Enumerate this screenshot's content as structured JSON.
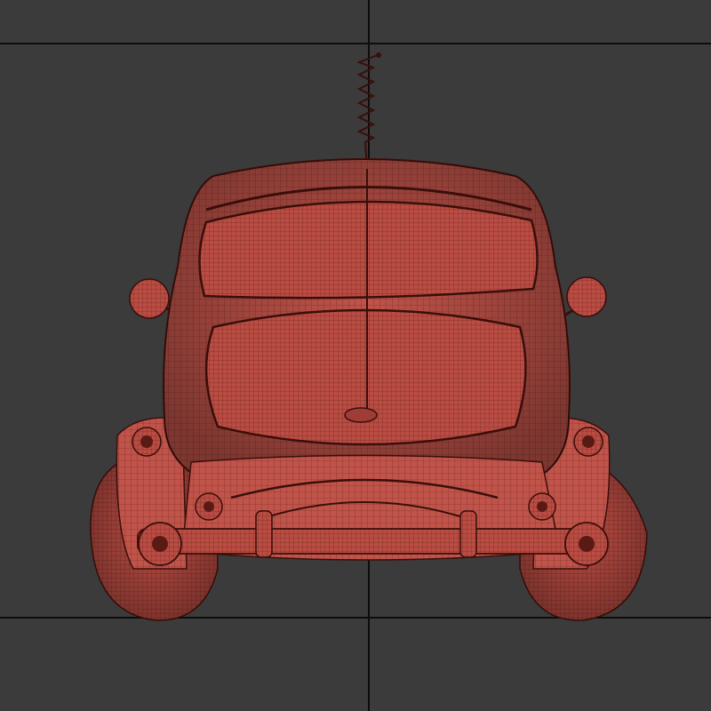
{
  "viewport": {
    "background_color": "#3b3b3b",
    "grid_line_color": "#0d0d0d"
  },
  "model": {
    "view": "rear",
    "render_mode": "wireframe",
    "shading_color": "#c0544a",
    "wire_color": "#5a1a14",
    "parts": [
      "antenna",
      "roof",
      "rear-window",
      "body",
      "trunk-lid",
      "trunk-badge",
      "bumper",
      "wheels",
      "mirrors",
      "tail-lights"
    ]
  }
}
